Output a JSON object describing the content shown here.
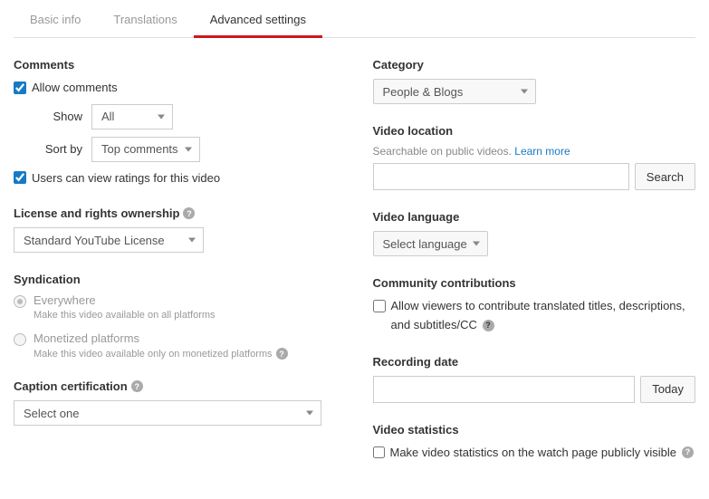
{
  "tabs": {
    "basic": "Basic info",
    "translations": "Translations",
    "advanced": "Advanced settings"
  },
  "comments": {
    "title": "Comments",
    "allow_label": "Allow comments",
    "show_label": "Show",
    "show_value": "All",
    "sort_label": "Sort by",
    "sort_value": "Top comments",
    "ratings_label": "Users can view ratings for this video"
  },
  "license": {
    "title": "License and rights ownership",
    "value": "Standard YouTube License"
  },
  "syndication": {
    "title": "Syndication",
    "opts": [
      {
        "label": "Everywhere",
        "sub": "Make this video available on all platforms"
      },
      {
        "label": "Monetized platforms",
        "sub": "Make this video available only on monetized platforms"
      }
    ]
  },
  "caption": {
    "title": "Caption certification",
    "value": "Select one"
  },
  "category": {
    "title": "Category",
    "value": "People & Blogs"
  },
  "location": {
    "title": "Video location",
    "hint": "Searchable on public videos. ",
    "learn": "Learn more",
    "search_btn": "Search"
  },
  "language": {
    "title": "Video language",
    "value": "Select language"
  },
  "community": {
    "title": "Community contributions",
    "label": "Allow viewers to contribute translated titles, descriptions, and subtitles/CC"
  },
  "recording": {
    "title": "Recording date",
    "today_btn": "Today"
  },
  "stats": {
    "title": "Video statistics",
    "label": "Make video statistics on the watch page publicly visible"
  }
}
